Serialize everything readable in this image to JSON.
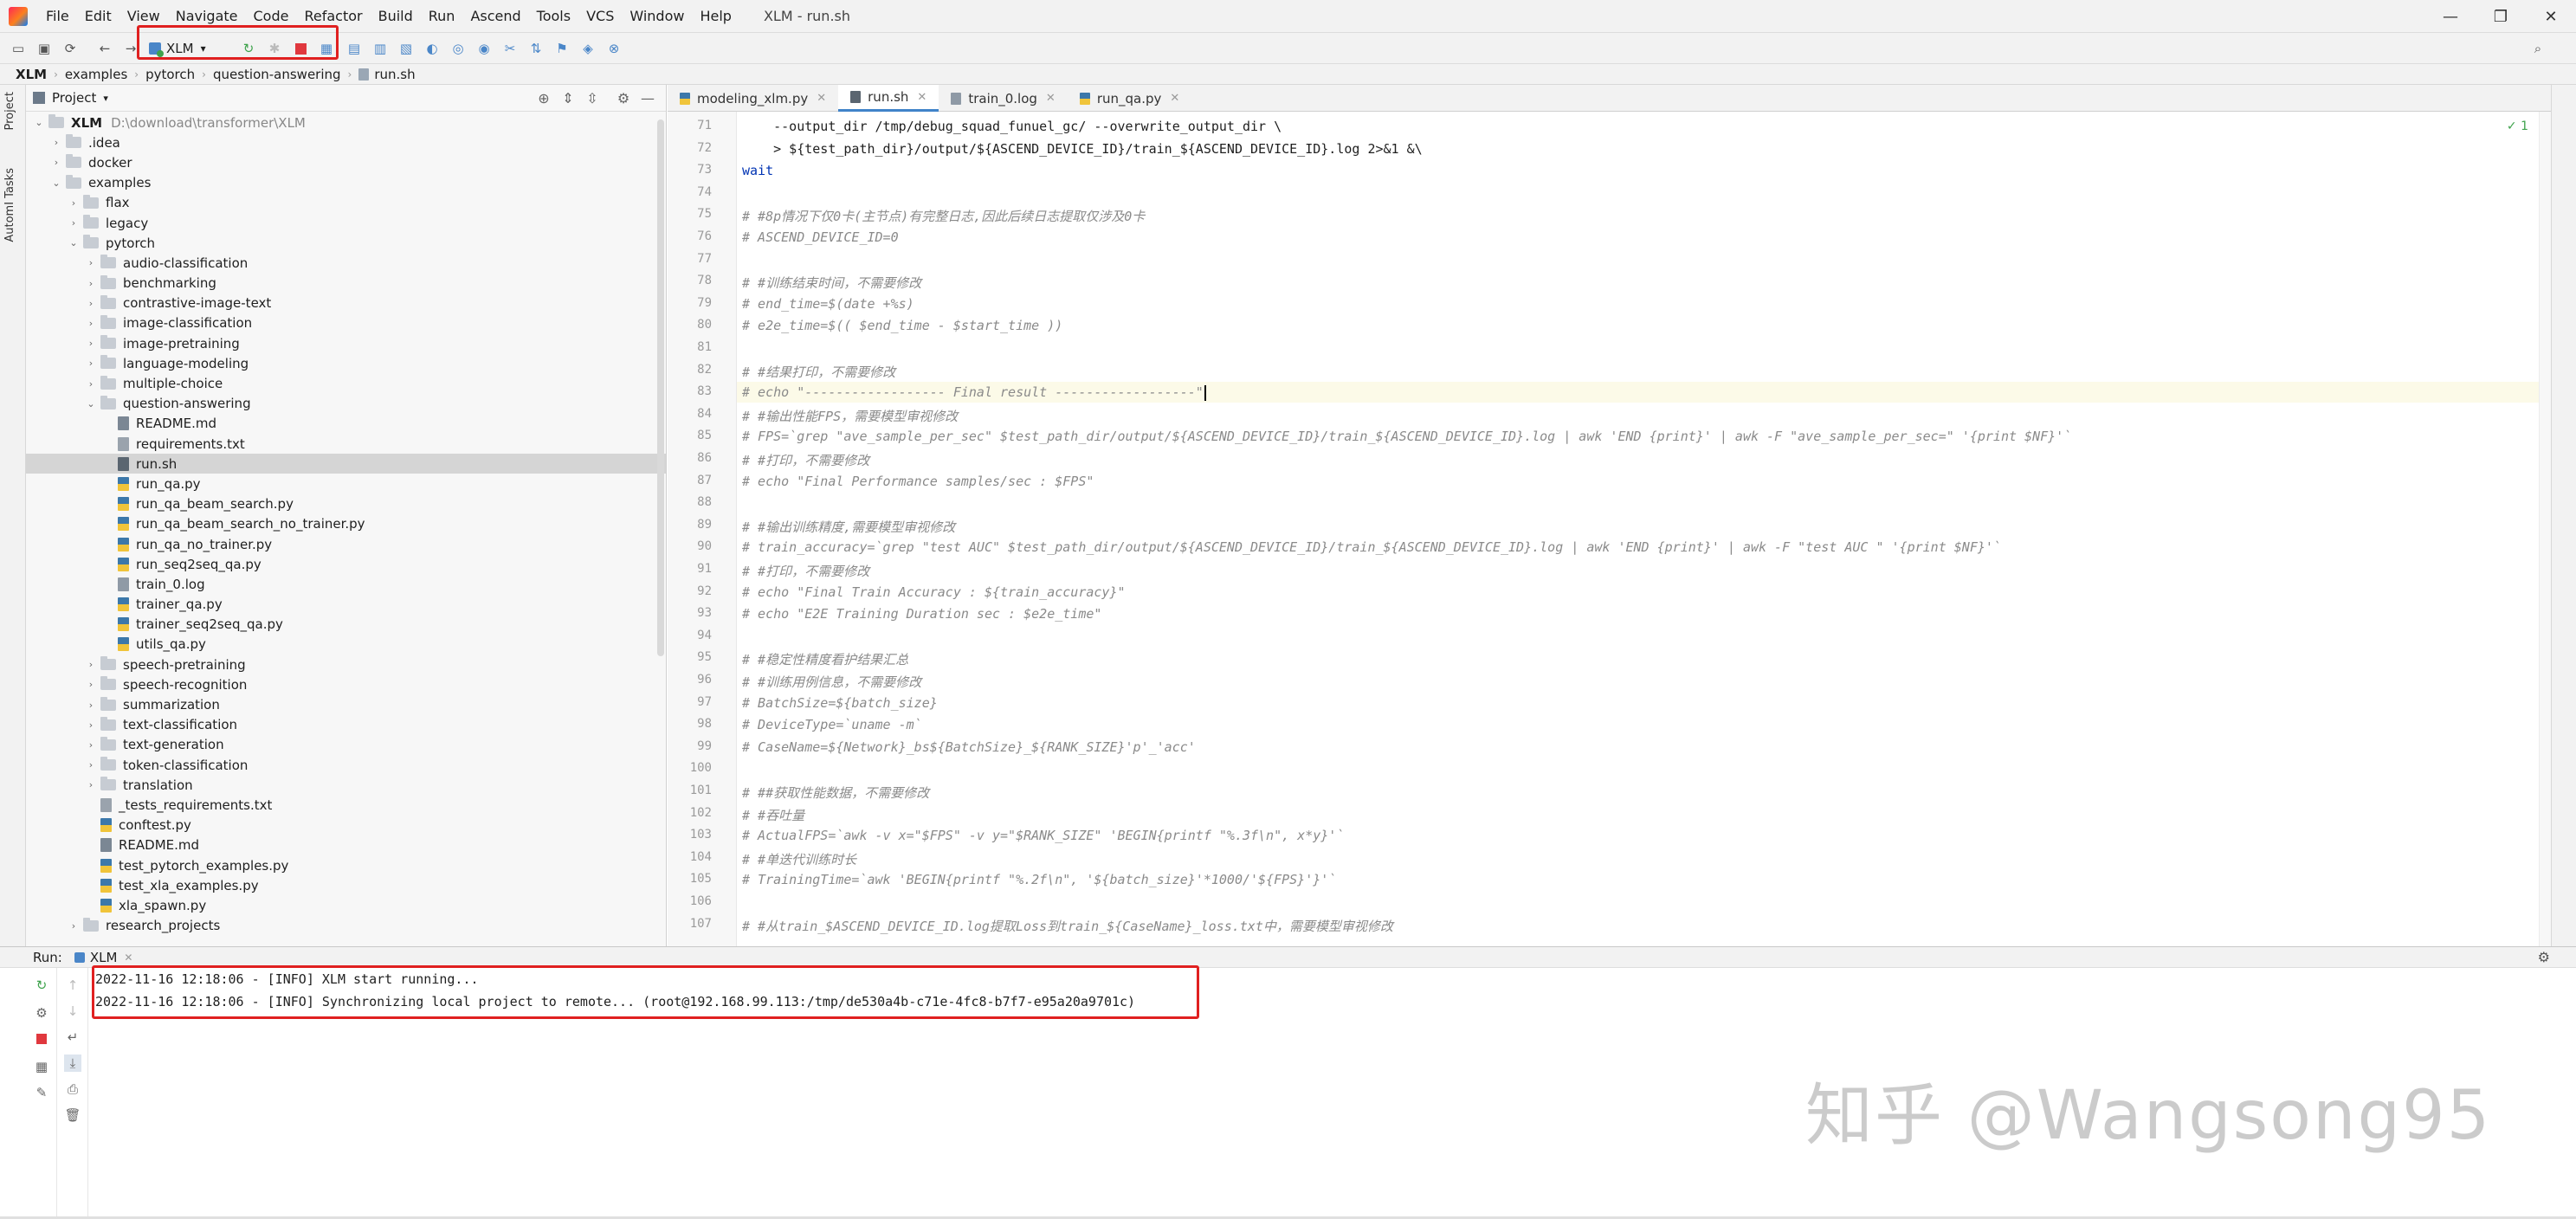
{
  "window": {
    "title": "XLM - run.sh",
    "menu": [
      "File",
      "Edit",
      "View",
      "Navigate",
      "Code",
      "Refactor",
      "Build",
      "Run",
      "Ascend",
      "Tools",
      "VCS",
      "Window",
      "Help"
    ],
    "controls": {
      "minimize": "—",
      "restore": "❐",
      "close": "✕"
    }
  },
  "toolbar": {
    "run_config_label": "XLM",
    "run_config_arrow": "▾",
    "highlight_color": "#e02020"
  },
  "breadcrumb": [
    "XLM",
    "examples",
    "pytorch",
    "question-answering",
    "run.sh"
  ],
  "left_strip": {
    "project_tab": "Project",
    "tasks_tab": "AutomI Tasks"
  },
  "project": {
    "header_label": "Project",
    "tree": [
      {
        "name": "XLM",
        "path": "D:\\download\\transformer\\XLM",
        "type": "folder",
        "depth": 0,
        "open": true,
        "bold": true
      },
      {
        "name": ".idea",
        "type": "folder",
        "depth": 1,
        "open": false
      },
      {
        "name": "docker",
        "type": "folder",
        "depth": 1,
        "open": false
      },
      {
        "name": "examples",
        "type": "folder",
        "depth": 1,
        "open": true
      },
      {
        "name": "flax",
        "type": "folder",
        "depth": 2,
        "open": false
      },
      {
        "name": "legacy",
        "type": "folder",
        "depth": 2,
        "open": false
      },
      {
        "name": "pytorch",
        "type": "folder",
        "depth": 2,
        "open": true
      },
      {
        "name": "audio-classification",
        "type": "folder",
        "depth": 3,
        "open": false
      },
      {
        "name": "benchmarking",
        "type": "folder",
        "depth": 3,
        "open": false
      },
      {
        "name": "contrastive-image-text",
        "type": "folder",
        "depth": 3,
        "open": false
      },
      {
        "name": "image-classification",
        "type": "folder",
        "depth": 3,
        "open": false
      },
      {
        "name": "image-pretraining",
        "type": "folder",
        "depth": 3,
        "open": false
      },
      {
        "name": "language-modeling",
        "type": "folder",
        "depth": 3,
        "open": false
      },
      {
        "name": "multiple-choice",
        "type": "folder",
        "depth": 3,
        "open": false
      },
      {
        "name": "question-answering",
        "type": "folder",
        "depth": 3,
        "open": true
      },
      {
        "name": "README.md",
        "type": "md",
        "depth": 4
      },
      {
        "name": "requirements.txt",
        "type": "txt",
        "depth": 4
      },
      {
        "name": "run.sh",
        "type": "sh",
        "depth": 4,
        "selected": true
      },
      {
        "name": "run_qa.py",
        "type": "py",
        "depth": 4
      },
      {
        "name": "run_qa_beam_search.py",
        "type": "py",
        "depth": 4
      },
      {
        "name": "run_qa_beam_search_no_trainer.py",
        "type": "py",
        "depth": 4
      },
      {
        "name": "run_qa_no_trainer.py",
        "type": "py",
        "depth": 4
      },
      {
        "name": "run_seq2seq_qa.py",
        "type": "py",
        "depth": 4
      },
      {
        "name": "train_0.log",
        "type": "log",
        "depth": 4
      },
      {
        "name": "trainer_qa.py",
        "type": "py",
        "depth": 4
      },
      {
        "name": "trainer_seq2seq_qa.py",
        "type": "py",
        "depth": 4
      },
      {
        "name": "utils_qa.py",
        "type": "py",
        "depth": 4
      },
      {
        "name": "speech-pretraining",
        "type": "folder",
        "depth": 3,
        "open": false
      },
      {
        "name": "speech-recognition",
        "type": "folder",
        "depth": 3,
        "open": false
      },
      {
        "name": "summarization",
        "type": "folder",
        "depth": 3,
        "open": false
      },
      {
        "name": "text-classification",
        "type": "folder",
        "depth": 3,
        "open": false
      },
      {
        "name": "text-generation",
        "type": "folder",
        "depth": 3,
        "open": false
      },
      {
        "name": "token-classification",
        "type": "folder",
        "depth": 3,
        "open": false
      },
      {
        "name": "translation",
        "type": "folder",
        "depth": 3,
        "open": false
      },
      {
        "name": "_tests_requirements.txt",
        "type": "txt",
        "depth": 3
      },
      {
        "name": "conftest.py",
        "type": "py",
        "depth": 3
      },
      {
        "name": "README.md",
        "type": "md",
        "depth": 3
      },
      {
        "name": "test_pytorch_examples.py",
        "type": "py",
        "depth": 3
      },
      {
        "name": "test_xla_examples.py",
        "type": "py",
        "depth": 3
      },
      {
        "name": "xla_spawn.py",
        "type": "py",
        "depth": 3
      },
      {
        "name": "research_projects",
        "type": "folder",
        "depth": 2,
        "open": false
      }
    ]
  },
  "editor": {
    "tabs": [
      {
        "label": "modeling_xlm.py",
        "type": "py",
        "active": false
      },
      {
        "label": "run.sh",
        "type": "sh",
        "active": true
      },
      {
        "label": "train_0.log",
        "type": "log",
        "active": false
      },
      {
        "label": "run_qa.py",
        "type": "py",
        "active": false
      }
    ],
    "inspection": "✓ 1",
    "current_line": 83,
    "lines": [
      {
        "n": 71,
        "text": "    --output_dir /tmp/debug_squad_funuel_gc/ --overwrite_output_dir \\",
        "style": ""
      },
      {
        "n": 72,
        "text": "    > ${test_path_dir}/output/${ASCEND_DEVICE_ID}/train_${ASCEND_DEVICE_ID}.log 2>&1 &\\",
        "style": ""
      },
      {
        "n": 73,
        "text": "wait",
        "style": "kw"
      },
      {
        "n": 74,
        "text": "",
        "style": ""
      },
      {
        "n": 75,
        "text": "# #8p情况下仅0卡(主节点)有完整日志,因此后续日志提取仅涉及0卡",
        "style": "cmt"
      },
      {
        "n": 76,
        "text": "# ASCEND_DEVICE_ID=0",
        "style": "cmt"
      },
      {
        "n": 77,
        "text": "",
        "style": ""
      },
      {
        "n": 78,
        "text": "# #训练结束时间，不需要修改",
        "style": "cmt"
      },
      {
        "n": 79,
        "text": "# end_time=$(date +%s)",
        "style": "cmt"
      },
      {
        "n": 80,
        "text": "# e2e_time=$(( $end_time - $start_time ))",
        "style": "cmt"
      },
      {
        "n": 81,
        "text": "",
        "style": ""
      },
      {
        "n": 82,
        "text": "# #结果打印，不需要修改",
        "style": "cmt"
      },
      {
        "n": 83,
        "text": "# echo \"------------------ Final result ------------------\"",
        "style": "cmt"
      },
      {
        "n": 84,
        "text": "# #输出性能FPS，需要模型审视修改",
        "style": "cmt"
      },
      {
        "n": 85,
        "text": "# FPS=`grep \"ave_sample_per_sec\" $test_path_dir/output/${ASCEND_DEVICE_ID}/train_${ASCEND_DEVICE_ID}.log | awk 'END {print}' | awk -F \"ave_sample_per_sec=\" '{print $NF}'`",
        "style": "cmt"
      },
      {
        "n": 86,
        "text": "# #打印，不需要修改",
        "style": "cmt"
      },
      {
        "n": 87,
        "text": "# echo \"Final Performance samples/sec : $FPS\"",
        "style": "cmt"
      },
      {
        "n": 88,
        "text": "",
        "style": ""
      },
      {
        "n": 89,
        "text": "# #输出训练精度,需要模型审视修改",
        "style": "cmt"
      },
      {
        "n": 90,
        "text": "# train_accuracy=`grep \"test AUC\" $test_path_dir/output/${ASCEND_DEVICE_ID}/train_${ASCEND_DEVICE_ID}.log | awk 'END {print}' | awk -F \"test AUC \" '{print $NF}'`",
        "style": "cmt"
      },
      {
        "n": 91,
        "text": "# #打印，不需要修改",
        "style": "cmt"
      },
      {
        "n": 92,
        "text": "# echo \"Final Train Accuracy : ${train_accuracy}\"",
        "style": "cmt"
      },
      {
        "n": 93,
        "text": "# echo \"E2E Training Duration sec : $e2e_time\"",
        "style": "cmt"
      },
      {
        "n": 94,
        "text": "",
        "style": ""
      },
      {
        "n": 95,
        "text": "# #稳定性精度看护结果汇总",
        "style": "cmt"
      },
      {
        "n": 96,
        "text": "# #训练用例信息，不需要修改",
        "style": "cmt"
      },
      {
        "n": 97,
        "text": "# BatchSize=${batch_size}",
        "style": "cmt"
      },
      {
        "n": 98,
        "text": "# DeviceType=`uname -m`",
        "style": "cmt"
      },
      {
        "n": 99,
        "text": "# CaseName=${Network}_bs${BatchSize}_${RANK_SIZE}'p'_'acc'",
        "style": "cmt"
      },
      {
        "n": 100,
        "text": "",
        "style": ""
      },
      {
        "n": 101,
        "text": "# ##获取性能数据，不需要修改",
        "style": "cmt"
      },
      {
        "n": 102,
        "text": "# #吞吐量",
        "style": "cmt"
      },
      {
        "n": 103,
        "text": "# ActualFPS=`awk -v x=\"$FPS\" -v y=\"$RANK_SIZE\" 'BEGIN{printf \"%.3f\\n\", x*y}'`",
        "style": "cmt"
      },
      {
        "n": 104,
        "text": "# #单迭代训练时长",
        "style": "cmt"
      },
      {
        "n": 105,
        "text": "# TrainingTime=`awk 'BEGIN{printf \"%.2f\\n\", '${batch_size}'*1000/'${FPS}'}'`",
        "style": "cmt"
      },
      {
        "n": 106,
        "text": "",
        "style": ""
      },
      {
        "n": 107,
        "text": "# #从train_$ASCEND_DEVICE_ID.log提取Loss到train_${CaseName}_loss.txt中，需要模型审视修改",
        "style": "cmt"
      }
    ]
  },
  "run_panel": {
    "label": "Run:",
    "tab_label": "XLM",
    "console": [
      "2022-11-16 12:18:06 - [INFO] XLM start running...",
      "2022-11-16 12:18:06 - [INFO] Synchronizing local project to remote... (root@192.168.99.113:/tmp/de530a4b-c71e-4fc8-b7f7-e95a20a9701c)"
    ]
  },
  "watermark": "知乎 @Wangsong95"
}
